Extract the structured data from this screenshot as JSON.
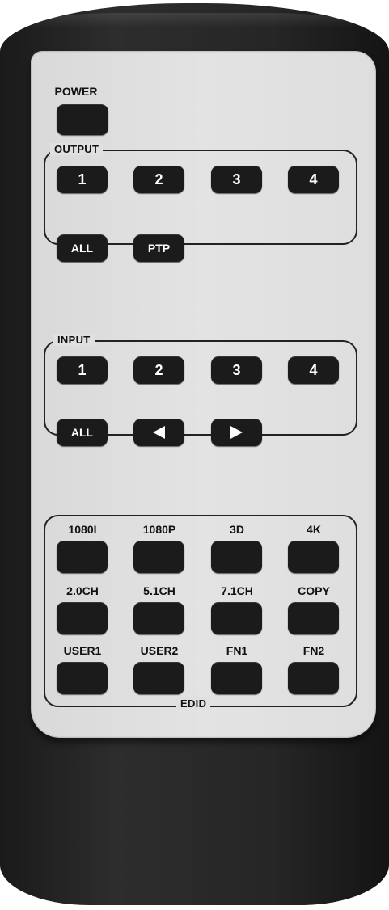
{
  "power": {
    "label": "POWER"
  },
  "output": {
    "title": "OUTPUT",
    "buttons": [
      "1",
      "2",
      "3",
      "4"
    ],
    "all": "ALL",
    "ptp": "PTP"
  },
  "input": {
    "title": "INPUT",
    "buttons": [
      "1",
      "2",
      "3",
      "4"
    ],
    "all": "ALL",
    "left_icon": "left-arrow",
    "right_icon": "right-arrow"
  },
  "edid": {
    "title": "EDID",
    "rows": [
      [
        "1080I",
        "1080P",
        "3D",
        "4K"
      ],
      [
        "2.0CH",
        "5.1CH",
        "7.1CH",
        "COPY"
      ],
      [
        "USER1",
        "USER2",
        "FN1",
        "FN2"
      ]
    ]
  },
  "colors": {
    "body": "#222222",
    "panel": "#e0e0e0",
    "button": "#1b1b1b"
  }
}
